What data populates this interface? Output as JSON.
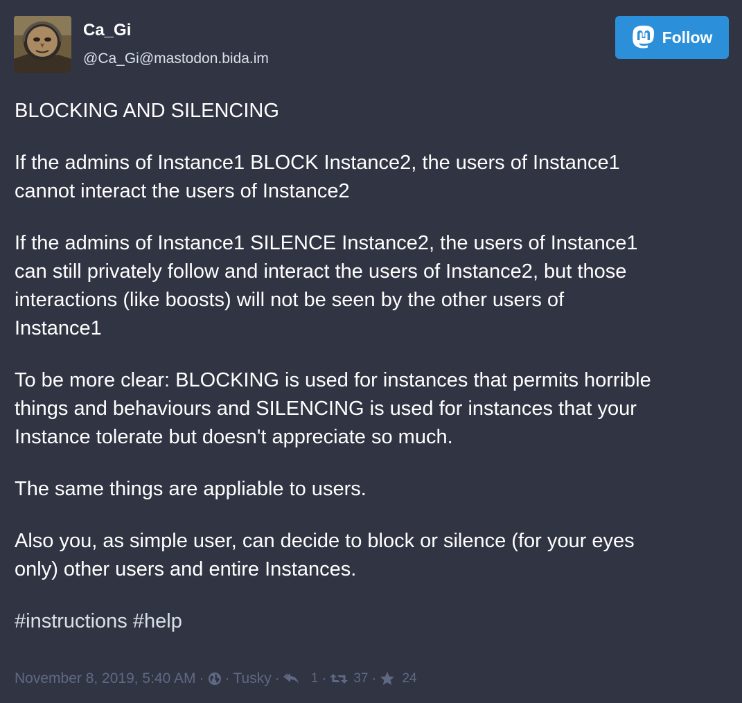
{
  "author": {
    "display_name": "Ca_Gi",
    "handle": "@Ca_Gi@mastodon.bida.im"
  },
  "follow_button": {
    "label": "Follow",
    "icon": "mastodon-logo-icon",
    "color": "#2b90d9"
  },
  "post": {
    "title": "BLOCKING AND SILENCING",
    "paragraph_1_line_1": "If the admins of Instance1 BLOCK Instance2, the users of Instance1",
    "paragraph_1_line_2": "cannot interact the users of Instance2",
    "paragraph_2_line_1": "If the admins of Instance1 SILENCE Instance2, the users of Instance1",
    "paragraph_2_line_2": "can still privately follow and interact the users of Instance2, but those",
    "paragraph_2_line_3": "interactions (like boosts) will not be seen by the other users of",
    "paragraph_2_line_4": "Instance1",
    "paragraph_3_line_1": "To be more clear: BLOCKING is used for instances that permits horrible",
    "paragraph_3_line_2": "things and behaviours and SILENCING is used for instances that your",
    "paragraph_3_line_3": "Instance tolerate but doesn't appreciate so much.",
    "paragraph_4": "The same things are appliable to users.",
    "paragraph_5_line_1": "Also you, as simple user, can decide to block or silence (for your eyes",
    "paragraph_5_line_2": "only) other users and entire Instances.",
    "hashtags": [
      "#instructions",
      "#help"
    ]
  },
  "meta": {
    "timestamp": "November 8, 2019, 5:40 AM",
    "separator": "·",
    "visibility_icon": "globe-icon",
    "application": "Tusky",
    "replies_count": "1",
    "boosts_count": "37",
    "favourites_count": "24"
  },
  "colors": {
    "background": "#313543",
    "text": "#ffffff",
    "secondary_text": "#d9e1e8",
    "meta_text": "#606984",
    "accent": "#2b90d9"
  }
}
